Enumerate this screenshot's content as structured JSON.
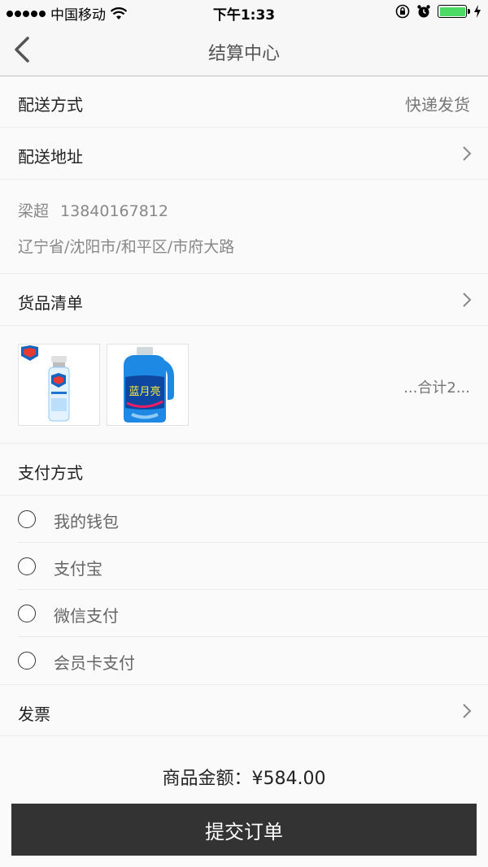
{
  "status_bar": {
    "carrier": "中国移动",
    "time": "下午1:33",
    "battery_color": "#4cd964"
  },
  "nav": {
    "title": "结算中心",
    "back_icon": "chevron-left-icon"
  },
  "delivery": {
    "method_label": "配送方式",
    "method_value": "快递发货",
    "address_label": "配送地址",
    "name": "梁超",
    "phone": "13840167812",
    "address": "辽宁省/沈阳市/和平区/市府大路"
  },
  "goods": {
    "label": "货品清单",
    "total_text": "...合计2...",
    "items": [
      {
        "icon": "shampoo-bottle-icon"
      },
      {
        "icon": "detergent-bottle-icon",
        "brand": "蓝月亮"
      }
    ]
  },
  "payment": {
    "label": "支付方式",
    "options": [
      {
        "name": "我的钱包"
      },
      {
        "name": "支付宝"
      },
      {
        "name": "微信支付"
      },
      {
        "name": "会员卡支付"
      }
    ]
  },
  "invoice": {
    "label": "发票"
  },
  "summary": {
    "amount_text": "商品金额：¥584.00",
    "submit_label": "提交订单"
  }
}
